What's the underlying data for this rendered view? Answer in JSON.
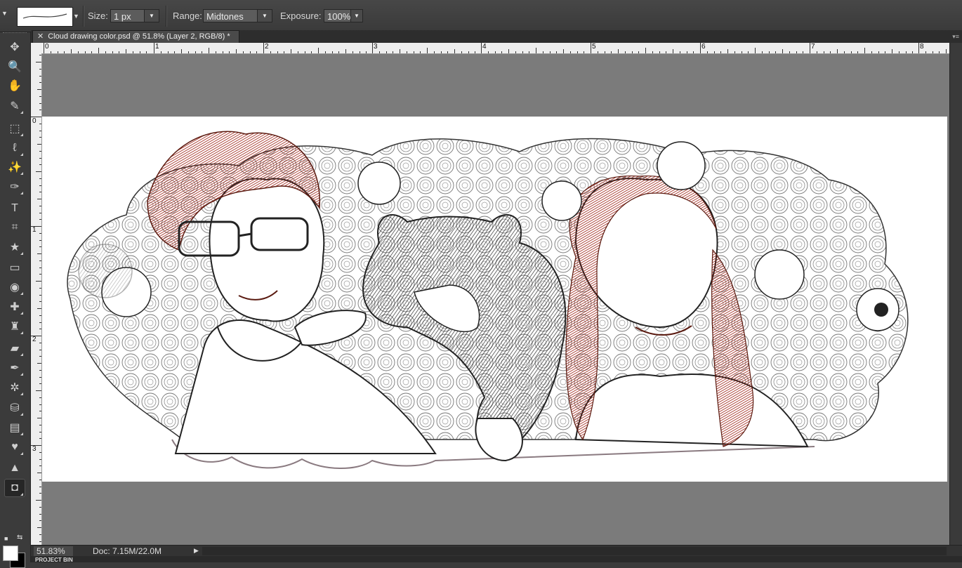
{
  "options_bar": {
    "size_label": "Size:",
    "size_value": "1 px",
    "range_label": "Range:",
    "range_value": "Midtones",
    "exposure_label": "Exposure:",
    "exposure_value": "100%"
  },
  "document_tab": {
    "title": "Cloud drawing color.psd @ 51.8% (Layer 2, RGB/8) *"
  },
  "rulers": {
    "top_numbers": [
      "0",
      "1",
      "2",
      "3",
      "4",
      "5",
      "6",
      "7",
      "8"
    ],
    "left_numbers": [
      "0",
      "1",
      "2",
      "3"
    ]
  },
  "status_bar": {
    "zoom": "51.83%",
    "doc_info": "Doc: 7.15M/22.0M"
  },
  "project_bin": {
    "label": "PROJECT BIN"
  },
  "tools": [
    {
      "name": "move-tool-icon",
      "glyph": "✥"
    },
    {
      "name": "zoom-tool-icon",
      "glyph": "🔍"
    },
    {
      "name": "hand-tool-icon",
      "glyph": "✋"
    },
    {
      "name": "eyedropper-tool-icon",
      "glyph": "✎"
    },
    {
      "name": "marquee-tool-icon",
      "glyph": "⬚"
    },
    {
      "name": "lasso-tool-icon",
      "glyph": "ℓ"
    },
    {
      "name": "magic-wand-tool-icon",
      "glyph": "✨"
    },
    {
      "name": "quick-selection-tool-icon",
      "glyph": "✑"
    },
    {
      "name": "type-tool-icon",
      "glyph": "T"
    },
    {
      "name": "crop-tool-icon",
      "glyph": "⌗"
    },
    {
      "name": "cookie-cutter-tool-icon",
      "glyph": "★"
    },
    {
      "name": "straighten-tool-icon",
      "glyph": "▭"
    },
    {
      "name": "red-eye-tool-icon",
      "glyph": "◉"
    },
    {
      "name": "healing-brush-tool-icon",
      "glyph": "✚"
    },
    {
      "name": "clone-stamp-tool-icon",
      "glyph": "♜"
    },
    {
      "name": "eraser-tool-icon",
      "glyph": "▰"
    },
    {
      "name": "brush-tool-icon",
      "glyph": "✒"
    },
    {
      "name": "smart-brush-tool-icon",
      "glyph": "✲"
    },
    {
      "name": "paint-bucket-tool-icon",
      "glyph": "⛁"
    },
    {
      "name": "gradient-tool-icon",
      "glyph": "▤"
    },
    {
      "name": "custom-shape-tool-icon",
      "glyph": "♥"
    },
    {
      "name": "blur-tool-icon",
      "glyph": "▲"
    },
    {
      "name": "sponge-tool-icon",
      "glyph": "◘"
    }
  ],
  "colors": {
    "foreground": "#ffffff",
    "background": "#000000",
    "accent_hair": "#8b1a0f"
  }
}
